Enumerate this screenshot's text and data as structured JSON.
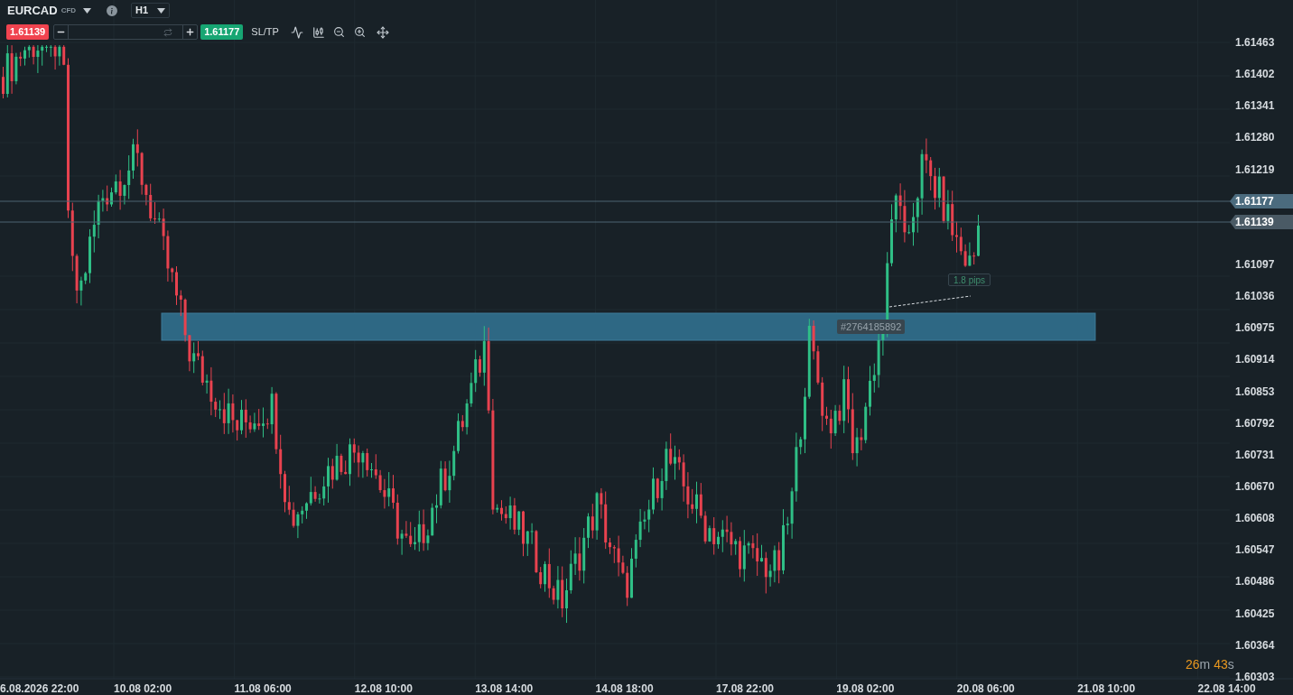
{
  "symbol": {
    "name": "EURCAD",
    "type": "CFD"
  },
  "timeframe": "H1",
  "order_bar": {
    "bid": "1.61139",
    "ask": "1.61177",
    "sl_tp": "SL/TP"
  },
  "price_axis": [
    "1.61463",
    "1.61402",
    "1.61341",
    "1.61280",
    "1.61219",
    "1.61097",
    "1.61036",
    "1.60975",
    "1.60914",
    "1.60853",
    "1.60792",
    "1.60731",
    "1.60670",
    "1.60608",
    "1.60547",
    "1.60486",
    "1.60425",
    "1.60364",
    "1.60303"
  ],
  "price_tags": [
    {
      "price": "1.61177",
      "color": "#4b6b7e"
    },
    {
      "price": "1.61139",
      "color": "#4a5a65"
    }
  ],
  "time_axis": [
    "6.08.2026 22:00",
    "10.08 02:00",
    "11.08 06:00",
    "12.08 10:00",
    "13.08 14:00",
    "14.08 18:00",
    "17.08 22:00",
    "19.08 02:00",
    "20.08 06:00",
    "21.08 10:00",
    "22.08 14:00"
  ],
  "zone": {
    "label": "#2764185892"
  },
  "distance": "1.8 pips",
  "countdown": {
    "minutes": "26",
    "minutes_unit": "m",
    "seconds": "43",
    "seconds_unit": "s"
  }
}
